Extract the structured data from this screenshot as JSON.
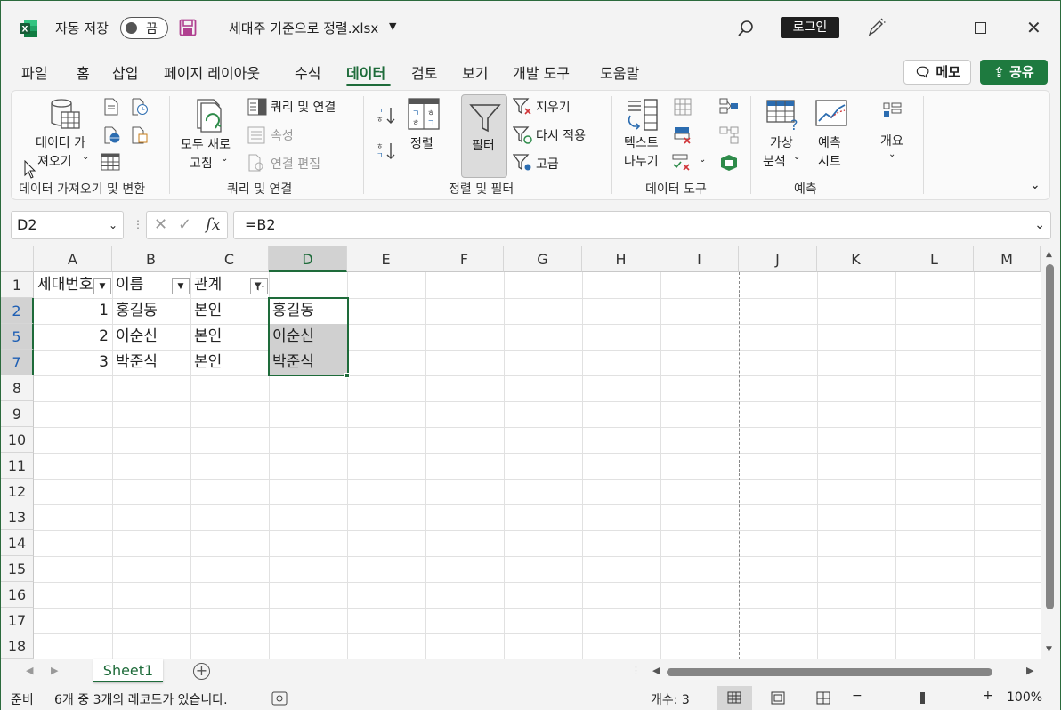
{
  "titlebar": {
    "autosave_label": "자동 저장",
    "autosave_state": "끔",
    "filename": "세대주 기준으로 정렬.xlsx",
    "login_label": "로그인"
  },
  "menu": {
    "tabs": [
      {
        "label": "파일"
      },
      {
        "label": "홈"
      },
      {
        "label": "삽입"
      },
      {
        "label": "페이지 레이아웃"
      },
      {
        "label": "수식"
      },
      {
        "label": "데이터",
        "active": true
      },
      {
        "label": "검토"
      },
      {
        "label": "보기"
      },
      {
        "label": "개발 도구"
      },
      {
        "label": "도움말"
      }
    ],
    "memo_label": "메모",
    "share_label": "공유"
  },
  "ribbon": {
    "get_data_line1": "데이터 가",
    "get_data_line2": "져오기",
    "group_get_transform": "데이터 가져오기 및 변환",
    "refresh_all_line1": "모두 새로",
    "refresh_all_line2": "고침",
    "queries_connections": "쿼리 및 연결",
    "properties": "속성",
    "edit_links": "연결 편집",
    "group_queries": "쿼리 및 연결",
    "sort": "정렬",
    "filter": "필터",
    "clear": "지우기",
    "reapply": "다시 적용",
    "advanced": "고급",
    "group_sort_filter": "정렬 및 필터",
    "text_to_columns_line1": "텍스트",
    "text_to_columns_line2": "나누기",
    "group_data_tools": "데이터 도구",
    "what_if_line1": "가상",
    "what_if_line2": "분석",
    "forecast_sheet_line1": "예측",
    "forecast_sheet_line2": "시트",
    "group_forecast": "예측",
    "outline": "개요"
  },
  "formula_bar": {
    "name_box": "D2",
    "formula": "=B2"
  },
  "grid": {
    "columns": [
      "A",
      "B",
      "C",
      "D",
      "E",
      "F",
      "G",
      "H",
      "I",
      "J",
      "K",
      "L",
      "M"
    ],
    "selected_column": "D",
    "rows": [
      "1",
      "2",
      "5",
      "7",
      "8",
      "9",
      "10",
      "11",
      "12",
      "13",
      "14",
      "15",
      "16",
      "17",
      "18"
    ],
    "selected_rows": [
      "2",
      "5",
      "7"
    ],
    "header_row": [
      "세대번호",
      "이름",
      "관계"
    ],
    "data": [
      {
        "a": "1",
        "b": "홍길동",
        "c": "본인",
        "d": "홍길동"
      },
      {
        "a": "2",
        "b": "이순신",
        "c": "본인",
        "d": "이순신"
      },
      {
        "a": "3",
        "b": "박준식",
        "c": "본인",
        "d": "박준식"
      }
    ]
  },
  "sheets": {
    "tabs": [
      "Sheet1"
    ]
  },
  "status": {
    "mode": "준비",
    "filter_info": "6개 중 3개의 레코드가 있습니다.",
    "count": "개수: 3",
    "zoom": "100%"
  }
}
